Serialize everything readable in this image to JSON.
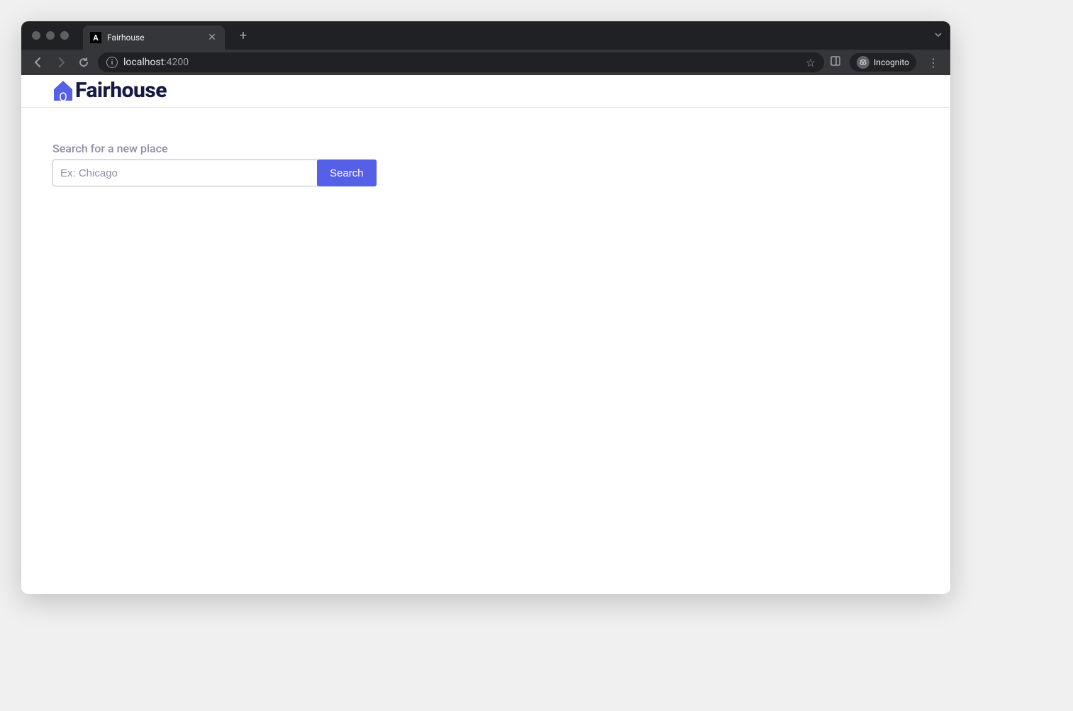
{
  "browser": {
    "tab": {
      "title": "Fairhouse",
      "favicon_letter": "A"
    },
    "url": {
      "host": "localhost",
      "port": ":4200"
    },
    "incognito_label": "Incognito"
  },
  "app": {
    "brand_name": "Fairhouse"
  },
  "search": {
    "label": "Search for a new place",
    "placeholder": "Ex: Chicago",
    "value": "",
    "button_label": "Search"
  },
  "colors": {
    "accent": "#5660e7",
    "brand_dark": "#161845"
  }
}
